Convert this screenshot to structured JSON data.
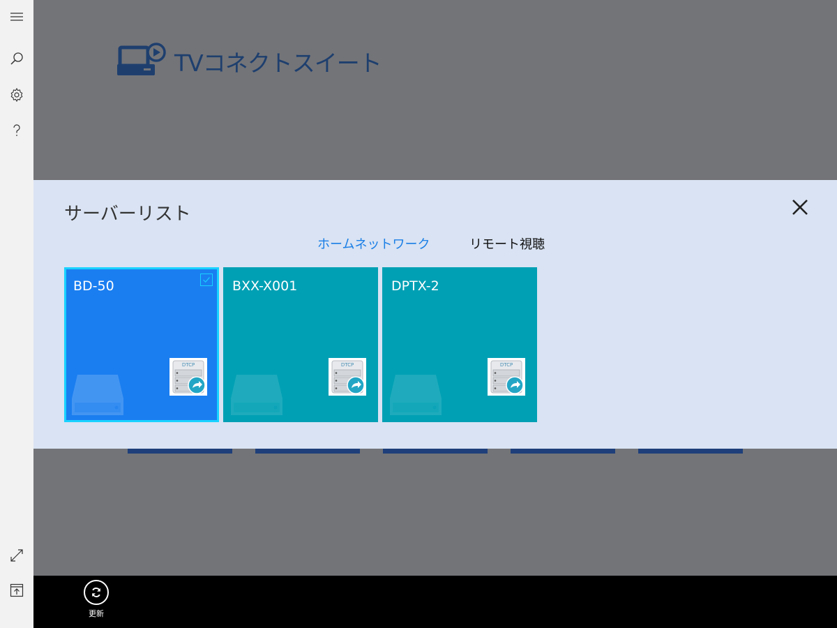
{
  "app": {
    "title": "TVコネクトスイート"
  },
  "rail": {
    "menu_icon": "hamburger-menu-icon",
    "search_icon": "search-icon",
    "settings_icon": "gear-icon",
    "help_icon": "help-icon",
    "fullscreen_icon": "expand-icon",
    "pin_icon": "upload-icon"
  },
  "panel": {
    "title": "サーバーリスト",
    "tabs": [
      {
        "label": "ホームネットワーク",
        "active": true
      },
      {
        "label": "リモート視聴",
        "active": false
      }
    ],
    "servers": [
      {
        "name": "BD-50",
        "selected": true
      },
      {
        "name": "BXX-X001",
        "selected": false
      },
      {
        "name": "DPTX-2",
        "selected": false
      }
    ],
    "dtcp_label": "DTCP"
  },
  "cmdbar": {
    "refresh_label": "更新"
  },
  "colors": {
    "accent": "#1a7ef0",
    "tile": "#00a0b4",
    "panel_bg": "#d9e3f3",
    "title_blue": "#1e3f6e"
  }
}
